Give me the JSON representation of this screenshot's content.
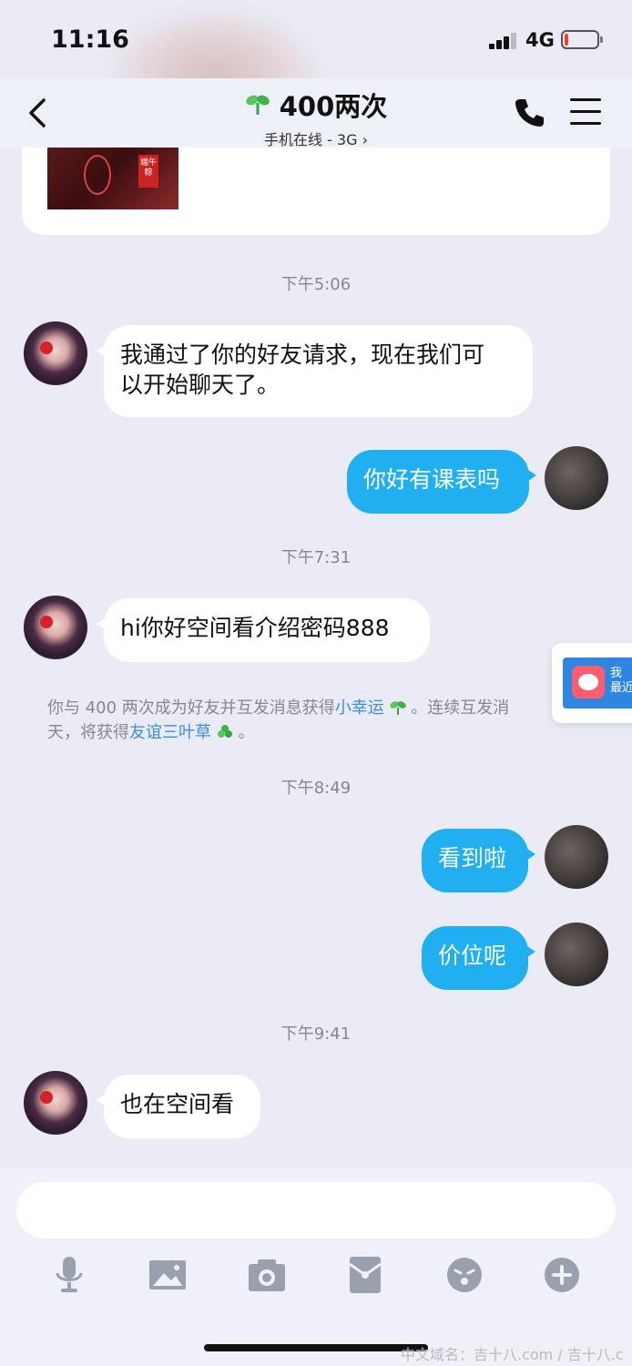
{
  "status_bar": {
    "time": "11:16",
    "network": "4G",
    "battery_level": 0.12,
    "battery_color": "#ff3b30"
  },
  "nav": {
    "title": "400两次",
    "subtitle": "手机在线 - 3G",
    "back_icon": "chevron-left-icon",
    "call_icon": "phone-icon",
    "menu_icon": "hamburger-menu-icon"
  },
  "shared_card": {
    "thumbnail_tag": "端午粽"
  },
  "messages": {
    "ts1": "下午5:06",
    "m1": "我通过了你的好友请求，现在我们可",
    "m1b": "以开始聊天了。",
    "m2": "你好有课表吗",
    "ts2": "下午7:31",
    "m3": "hi你好空间看介绍密码888",
    "system_a": "你与 400 两次成为好友并互发消息获得",
    "system_link1": "小幸运",
    "system_b": "。连续互发消",
    "system_c": "天，将获得",
    "system_link2": "友谊三叶草",
    "system_d": "。",
    "ts3": "下午8:49",
    "m4": "看到啦",
    "m5": "价位呢",
    "ts4": "下午9:41",
    "m6": "也在空间看"
  },
  "floating_card": {
    "line1": "我",
    "line2": "最近"
  },
  "input": {
    "placeholder": ""
  },
  "toolbar": {
    "icons": [
      "microphone-icon",
      "image-icon",
      "camera-icon",
      "red-packet-icon",
      "emoji-icon",
      "plus-icon"
    ]
  },
  "watermark": "中文域名：吉十八.com / 吉十八.c",
  "colors": {
    "my_bubble": "#20b0f2",
    "link": "#3b8de9",
    "background": "#eaebf4"
  }
}
